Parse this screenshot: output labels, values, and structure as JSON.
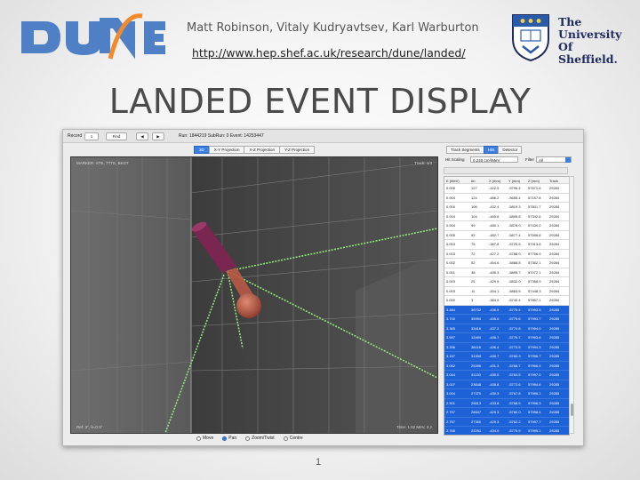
{
  "slide": {
    "authors": "Matt Robinson, Vitaly Kudryavtsev, Karl Warburton",
    "url": "http://www.hep.shef.ac.uk/research/dune/landed/",
    "title": "LANDED EVENT DISPLAY",
    "university": [
      "The",
      "University",
      "Of",
      "Sheffield."
    ],
    "page_number": "1",
    "colors": {
      "dune_blue": "#4f80c5",
      "dune_orange": "#f08a2b",
      "uni_navy": "#1f2b5e"
    }
  },
  "toolbar": {
    "record_label": "Record",
    "record_value": "1",
    "find_label": "Find",
    "prev_glyph": "◀",
    "next_glyph": "▶",
    "run_info": "Run: 1844219  SubRun: 0  Event: 14253447"
  },
  "view_tabs": [
    "3D",
    "X-Y Projection",
    "X-Z Projection",
    "Y-Z Projection"
  ],
  "active_view_tab": "3D",
  "viewport": {
    "top_left": "MARKER: STE, TTTE, BKGT",
    "top_right": "Track: 1/4",
    "bottom_left": "Ref: 3°, θ=0.0°",
    "bottom_right": "Time: 1.02 MeV, 3.2",
    "colors": {
      "background": "#4e4e4e",
      "track": "#8fe47a",
      "muon": "#7a2650",
      "hadron": "#b85a46"
    }
  },
  "modes": [
    {
      "label": "Move",
      "selected": false
    },
    {
      "label": "Pan",
      "selected": true
    },
    {
      "label": "Zoom/Twist",
      "selected": false
    },
    {
      "label": "Centre",
      "selected": false
    }
  ],
  "panel_tabs": [
    "Track Segments",
    "Hits",
    "Detector"
  ],
  "active_panel_tab": "Hits",
  "hit_scaling": {
    "label": "Hit Scaling",
    "value": "0.240 cm²/MeV"
  },
  "filter": {
    "label": "Filter",
    "value": "All"
  },
  "hits_table": {
    "columns": [
      "E (MeV)",
      "#n",
      "X (mm)",
      "Y (mm)",
      "Z (mm)",
      "Track"
    ],
    "rows": [
      {
        "cells": [
          "0.005",
          "127",
          "-422.5",
          "-5796.4",
          "57671.6",
          "29284"
        ],
        "selected": false
      },
      {
        "cells": [
          "0.004",
          "124",
          "-486.2",
          "-5655.4",
          "57157.8",
          "29284"
        ],
        "selected": false
      },
      {
        "cells": [
          "0.004",
          "106",
          "-432.4",
          "-5819.3",
          "57601.7",
          "29284"
        ],
        "selected": false
      },
      {
        "cells": [
          "0.004",
          "104",
          "-465.6",
          "-5895.8",
          "57342.6",
          "29284"
        ],
        "selected": false
      },
      {
        "cells": [
          "0.004",
          "99",
          "-480.1",
          "-5878.0",
          "57430.0",
          "29284"
        ],
        "selected": false
      },
      {
        "cells": [
          "0.005",
          "93",
          "-482.7",
          "-5877.4",
          "57596.8",
          "29284"
        ],
        "selected": false
      },
      {
        "cells": [
          "0.003",
          "75",
          "-387.8",
          "-5725.5",
          "57913.8",
          "29284"
        ],
        "selected": false
      },
      {
        "cells": [
          "0.003",
          "72",
          "-427.2",
          "-5788.0",
          "57756.9",
          "29284"
        ],
        "selected": false
      },
      {
        "cells": [
          "0.002",
          "52",
          "-454.6",
          "-5888.8",
          "57362.1",
          "29284"
        ],
        "selected": false
      },
      {
        "cells": [
          "0.001",
          "38",
          "-495.3",
          "-5895.7",
          "57072.1",
          "29284"
        ],
        "selected": false
      },
      {
        "cells": [
          "0.003",
          "25",
          "-429.5",
          "-5832.0",
          "57358.9",
          "29284"
        ],
        "selected": false
      },
      {
        "cells": [
          "0.003",
          "11",
          "-454.1",
          "-5863.5",
          "57448.3",
          "29284"
        ],
        "selected": false
      },
      {
        "cells": [
          "0.000",
          "3",
          "-384.9",
          "-5740.4",
          "57857.1",
          "29284"
        ],
        "selected": false
      },
      {
        "cells": [
          "3.484",
          "36732",
          "-436.5",
          "-5775.4",
          "57993.5",
          "29285"
        ],
        "selected": true
      },
      {
        "cells": [
          "3.700",
          "35990",
          "-435.0",
          "-5775.6",
          "57993.7",
          "29285"
        ],
        "selected": true
      },
      {
        "cells": [
          "3.365",
          "33416",
          "-437.2",
          "-5774.8",
          "57994.0",
          "29285"
        ],
        "selected": true
      },
      {
        "cells": [
          "3.597",
          "12490",
          "-436.7",
          "-5776.7",
          "57993.6",
          "29285"
        ],
        "selected": true
      },
      {
        "cells": [
          "3.336",
          "38118",
          "-436.4",
          "-5773.5",
          "57994.3",
          "29285"
        ],
        "selected": true
      },
      {
        "cells": [
          "3.157",
          "31308",
          "-430.7",
          "-5760.3",
          "57996.7",
          "29285"
        ],
        "selected": true
      },
      {
        "cells": [
          "3.062",
          "25396",
          "-431.3",
          "-5768.7",
          "57996.4",
          "29285"
        ],
        "selected": true
      },
      {
        "cells": [
          "3.044",
          "31130",
          "-430.0",
          "-5764.5",
          "57997.0",
          "29285"
        ],
        "selected": true
      },
      {
        "cells": [
          "3.007",
          "23648",
          "-435.8",
          "-5772.6",
          "57994.6",
          "29285"
        ],
        "selected": true
      },
      {
        "cells": [
          "3.004",
          "27370",
          "-430.3",
          "-5767.8",
          "57996.1",
          "29285"
        ],
        "selected": true
      },
      {
        "cells": [
          "2.901",
          "25613",
          "-433.8",
          "-5768.9",
          "57996.3",
          "29285"
        ],
        "selected": true
      },
      {
        "cells": [
          "2.797",
          "28547",
          "-429.3",
          "-5760.0",
          "57998.4",
          "29285"
        ],
        "selected": true
      },
      {
        "cells": [
          "2.757",
          "27360",
          "-429.3",
          "-5762.2",
          "57997.7",
          "29285"
        ],
        "selected": true
      },
      {
        "cells": [
          "2.766",
          "22291",
          "-434.0",
          "-5770.9",
          "57995.1",
          "29285"
        ],
        "selected": true
      },
      {
        "cells": [
          "2.757",
          "32727",
          "-430.4",
          "-5763.4",
          "57997.3",
          "29285"
        ],
        "selected": true
      }
    ]
  }
}
